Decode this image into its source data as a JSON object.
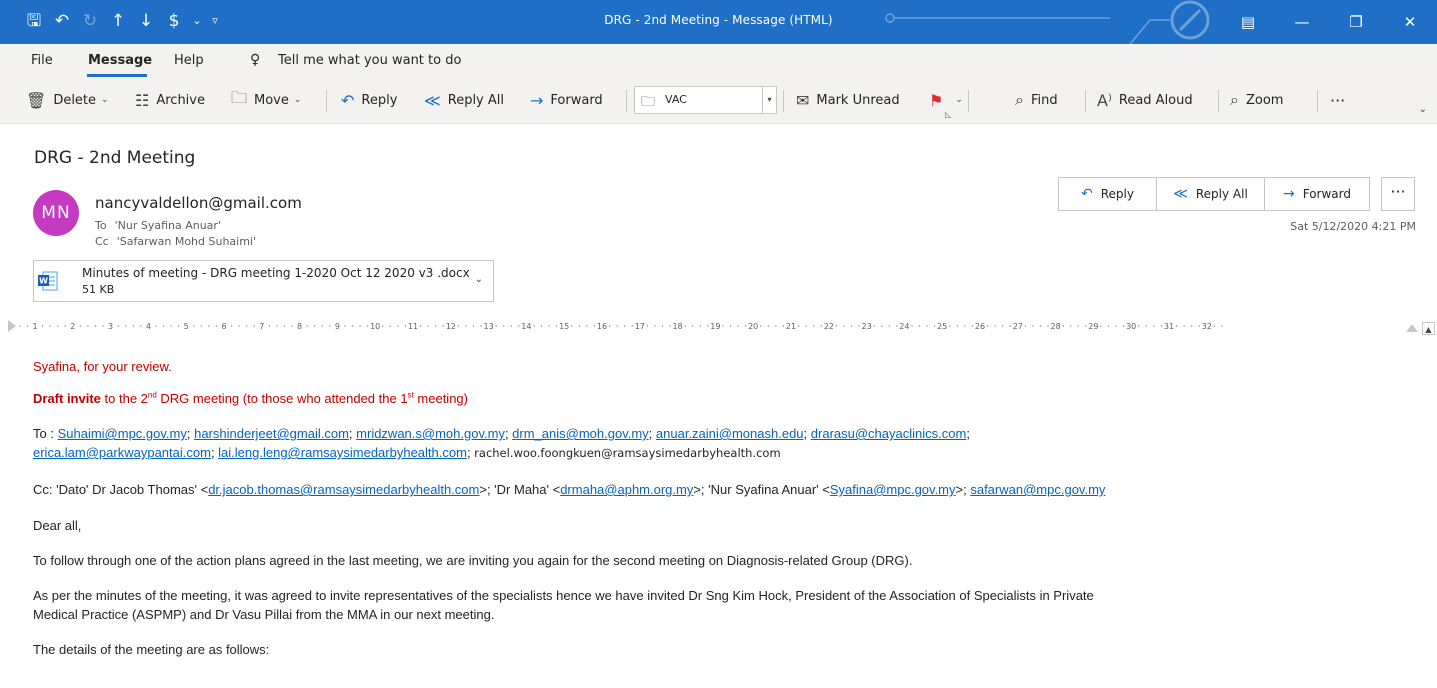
{
  "titlebar": {
    "title": "DRG - 2nd Meeting  -  Message (HTML)",
    "qat_icons": [
      "save-icon",
      "undo-icon",
      "redo-icon",
      "up-arrow-icon",
      "down-arrow-icon",
      "quick-steps-icon",
      "customize-icon"
    ]
  },
  "menu": {
    "file": "File",
    "message": "Message",
    "help": "Help",
    "tell_me": "Tell me what you want to do"
  },
  "ribbon": {
    "delete": "Delete",
    "archive": "Archive",
    "move": "Move",
    "reply": "Reply",
    "reply_all": "Reply All",
    "forward": "Forward",
    "quickstep_value": "VAC",
    "mark_unread": "Mark Unread",
    "find": "Find",
    "read_aloud": "Read Aloud",
    "zoom": "Zoom",
    "more": "···"
  },
  "message": {
    "subject": "DRG - 2nd Meeting",
    "avatar_initials": "MN",
    "avatar_color": "#c43bc1",
    "sender": "nancyvaldellon@gmail.com",
    "to_label": "To",
    "to": "'Nur Syafina Anuar'",
    "cc_label": "Cc",
    "cc": "'Safarwan Mohd Suhaimi'",
    "date": "Sat 5/12/2020 4:21 PM",
    "reply": "Reply",
    "reply_all": "Reply All",
    "forward": "Forward",
    "more": "···"
  },
  "attachment": {
    "name": "Minutes of meeting - DRG meeting 1-2020 Oct 12 2020 v3 .docx",
    "size": "51 KB"
  },
  "ruler": {
    "numbers": [
      "1",
      "2",
      "3",
      "4",
      "5",
      "6",
      "7",
      "8",
      "9",
      "10",
      "11",
      "12",
      "13",
      "14",
      "15",
      "16",
      "17",
      "18",
      "19",
      "20",
      "21",
      "22",
      "23",
      "24",
      "25",
      "26",
      "27",
      "28",
      "29",
      "30",
      "31",
      "32"
    ]
  },
  "body": {
    "line1": "Syafina, for your review.",
    "draft_bold": "Draft invite",
    "draft_rest_1": " to the 2",
    "draft_sup_1": "nd",
    "draft_rest_2": " DRG meeting (to those who attended the 1",
    "draft_sup_2": "st",
    "draft_rest_3": " meeting)",
    "to_prefix": "To : ",
    "to_emails_line1": [
      "Suhaimi@mpc.gov.my",
      "harshinderjeet@gmail.com",
      "mridzwan.s@moh.gov.my",
      "drm_anis@moh.gov.my",
      "anuar.zaini@monash.edu",
      "drarasu@chayaclinics.com"
    ],
    "to_emails_line2": [
      "erica.lam@parkwaypantai.com",
      "lai.leng.leng@ramsaysimedarbyhealth.com"
    ],
    "to_plain_email": "rachel.woo.foongkuen@ramsaysimedarbyhealth.com",
    "cc_prefix": "Cc: 'Dato' Dr Jacob Thomas' <",
    "cc_email1": "dr.jacob.thomas@ramsaysimedarbyhealth.com",
    "cc_mid1": ">; 'Dr Maha' <",
    "cc_email2": "drmaha@aphm.org.my",
    "cc_mid2": ">; 'Nur Syafina Anuar' <",
    "cc_email3": "Syafina@mpc.gov.my",
    "cc_mid3": ">; ",
    "cc_email4": "safarwan@mpc.gov.my",
    "greeting": "Dear all,",
    "para1": "To follow through one of the action plans agreed in the last meeting, we are inviting you again for the second meeting on Diagnosis-related Group (DRG).",
    "para2a": "As per the minutes of the meeting, it was agreed to invite representatives of the specialists hence we have invited Dr Sng Kim Hock, President of the Association of Specialists in Private",
    "para2b": "Medical Practice (ASPMP) and Dr Vasu Pillai from the MMA in our next meeting.",
    "para3": "The details of the meeting are as follows:"
  }
}
